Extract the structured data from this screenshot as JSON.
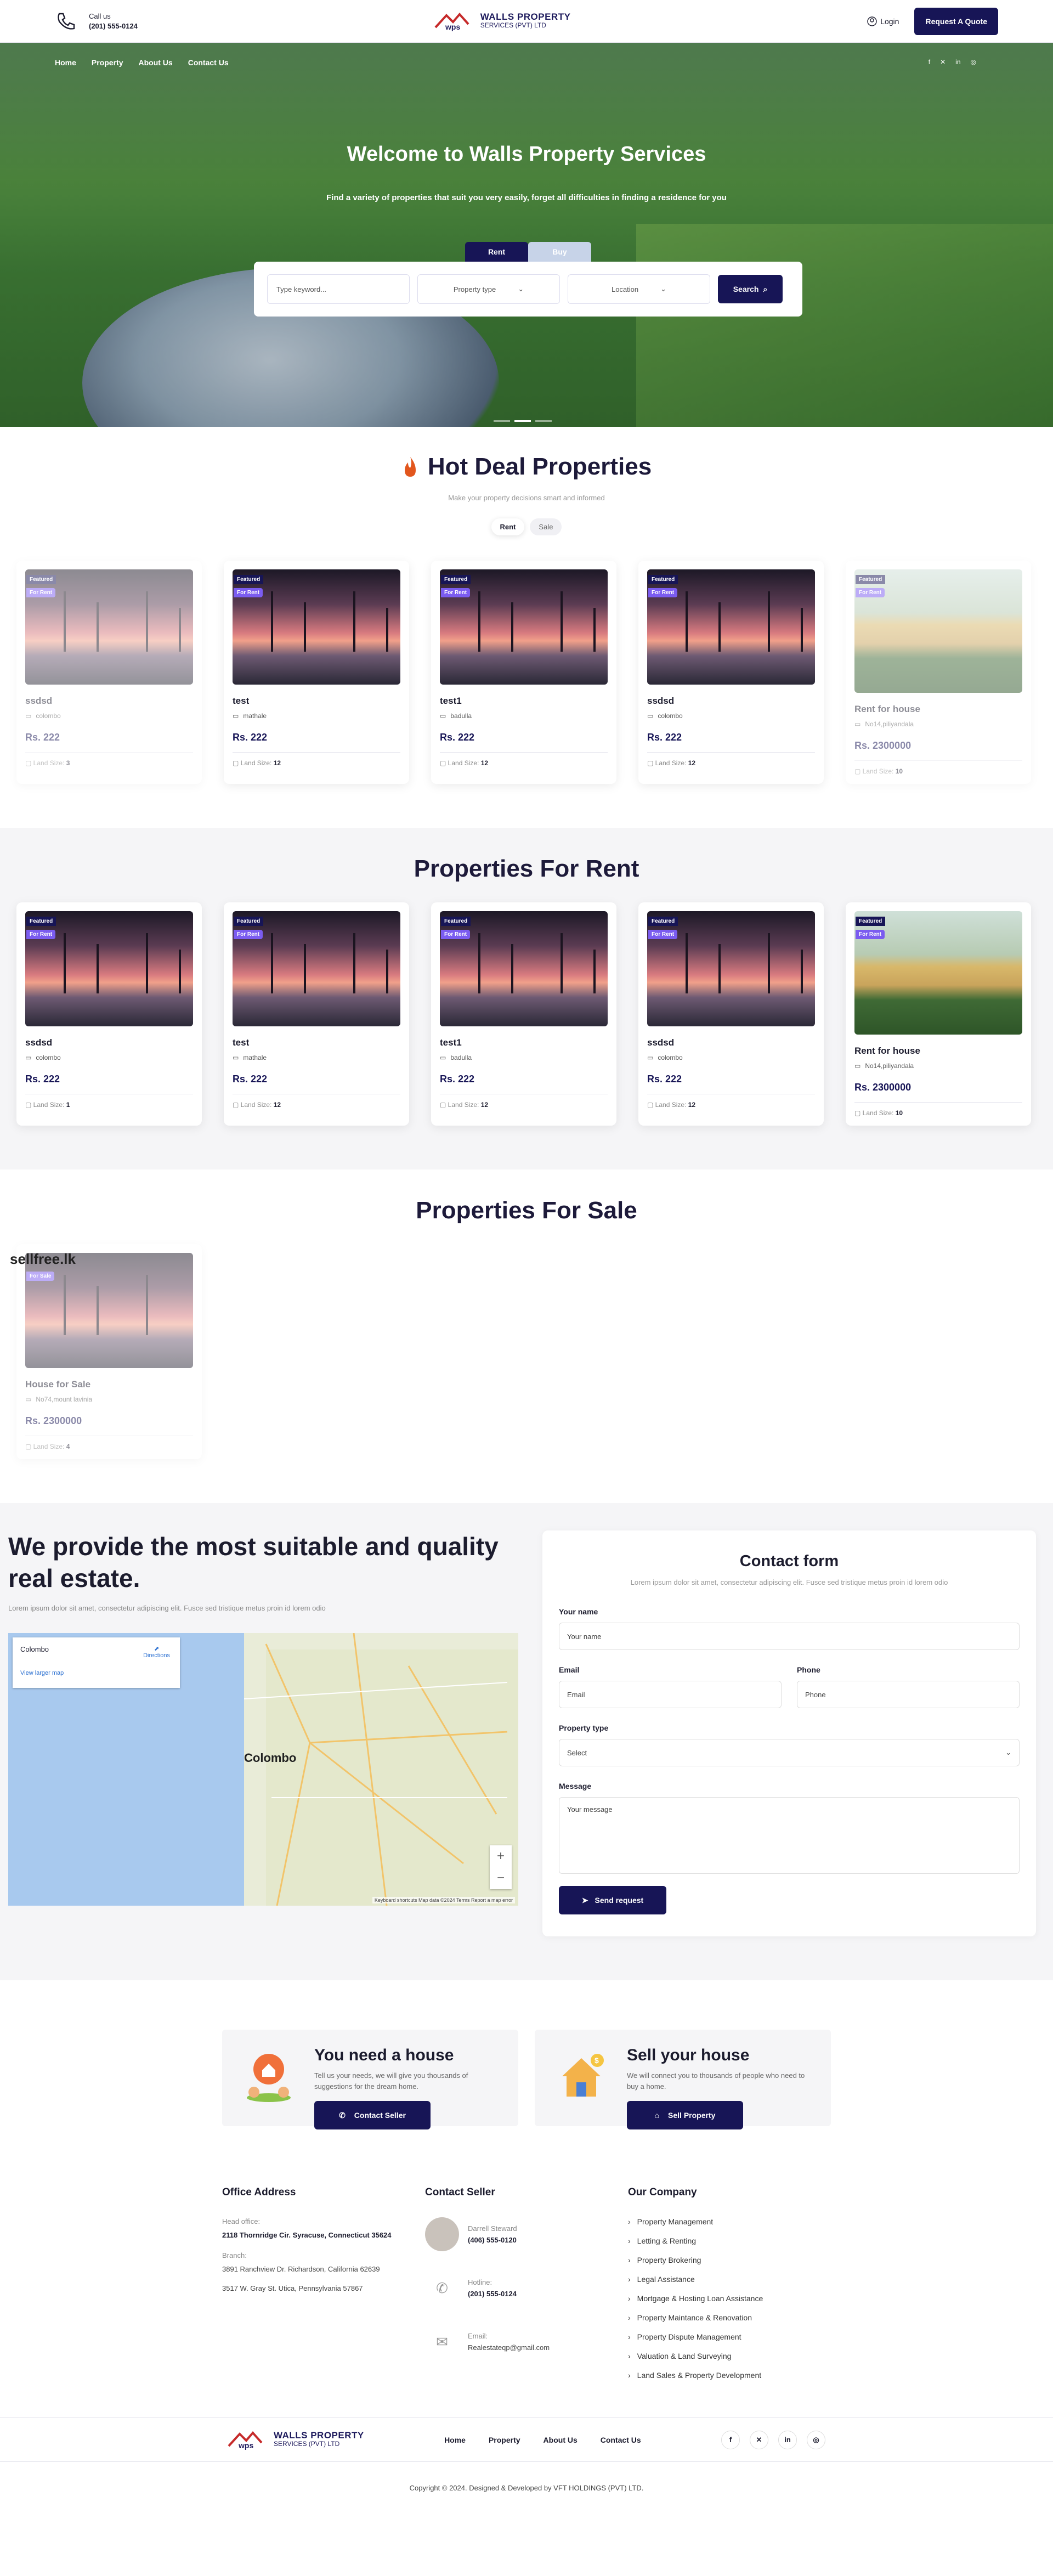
{
  "topbar": {
    "call_label": "Call us",
    "phone": "(201) 555-0124",
    "logo_line1": "WALLS PROPERTY",
    "logo_line2": "SERVICES (PVT) LTD",
    "login": "Login",
    "quote": "Request A Quote"
  },
  "nav": [
    "Home",
    "Property",
    "About Us",
    "Contact Us"
  ],
  "hero": {
    "title": "Welcome to Walls Property Services",
    "subtitle": "Find a variety of properties that suit you very easily, forget all difficulties in finding a residence for you",
    "tab_rent": "Rent",
    "tab_buy": "Buy",
    "keyword_placeholder": "Type keyword...",
    "property_type": "Property type",
    "location": "Location",
    "search": "Search"
  },
  "hot": {
    "title": "Hot Deal Properties",
    "subtitle": "Make your property decisions smart and informed",
    "pill_rent": "Rent",
    "pill_sale": "Sale",
    "cards": [
      {
        "b1": "Featured",
        "b2": "For Rent",
        "name": "ssdsd",
        "loc": "colombo",
        "price": "Rs. 222",
        "land": "Land Size:",
        "size": "3"
      },
      {
        "b1": "Featured",
        "b2": "For Rent",
        "name": "test",
        "loc": "mathale",
        "price": "Rs. 222",
        "land": "Land Size:",
        "size": "12"
      },
      {
        "b1": "Featured",
        "b2": "For Rent",
        "name": "test1",
        "loc": "badulla",
        "price": "Rs. 222",
        "land": "Land Size:",
        "size": "12"
      },
      {
        "b1": "Featured",
        "b2": "For Rent",
        "name": "ssdsd",
        "loc": "colombo",
        "price": "Rs. 222",
        "land": "Land Size:",
        "size": "12"
      },
      {
        "b1": "Featured",
        "b2": "For Rent",
        "name": "Rent for house",
        "loc": "No14,piliyandala",
        "price": "Rs. 2300000",
        "land": "Land Size:",
        "size": "10"
      }
    ]
  },
  "rent": {
    "title": "Properties For Rent",
    "cards": [
      {
        "b1": "Featured",
        "b2": "For Rent",
        "name": "ssdsd",
        "loc": "colombo",
        "price": "Rs. 222",
        "land": "Land Size:",
        "size": "1"
      },
      {
        "b1": "Featured",
        "b2": "For Rent",
        "name": "test",
        "loc": "mathale",
        "price": "Rs. 222",
        "land": "Land Size:",
        "size": "12"
      },
      {
        "b1": "Featured",
        "b2": "For Rent",
        "name": "test1",
        "loc": "badulla",
        "price": "Rs. 222",
        "land": "Land Size:",
        "size": "12"
      },
      {
        "b1": "Featured",
        "b2": "For Rent",
        "name": "ssdsd",
        "loc": "colombo",
        "price": "Rs. 222",
        "land": "Land Size:",
        "size": "12"
      },
      {
        "b1": "Featured",
        "b2": "For Rent",
        "name": "Rent for house",
        "loc": "No14,piliyandala",
        "price": "Rs. 2300000",
        "land": "Land Size:",
        "size": "10"
      }
    ]
  },
  "sale": {
    "title": "Properties For Sale",
    "watermark": "sellfree.lk",
    "card": {
      "b2": "For Sale",
      "name": "House for Sale",
      "loc": "No74,mount lavinia",
      "price": "Rs. 2300000",
      "land": "Land Size:",
      "size": "4"
    }
  },
  "provide": {
    "title": "We provide the most suitable and quality real estate.",
    "text": "Lorem ipsum dolor sit amet, consectetur adipiscing elit. Fusce sed tristique metus proin id lorem odio"
  },
  "map": {
    "place": "Colombo",
    "directions": "Directions",
    "larger": "View larger map",
    "city": "Colombo",
    "footer": "Keyboard shortcuts   Map data ©2024   Terms   Report a map error"
  },
  "form": {
    "title": "Contact form",
    "subtitle": "Lorem ipsum dolor sit amet, consectetur adipiscing elit. Fusce sed tristique metus proin id lorem odio",
    "name_label": "Your name",
    "name_ph": "Your name",
    "email_label": "Email",
    "email_ph": "Email",
    "phone_label": "Phone",
    "phone_ph": "Phone",
    "type_label": "Property type",
    "type_value": "Select",
    "msg_label": "Message",
    "msg_ph": "Your message",
    "send": "Send request"
  },
  "promo": [
    {
      "title": "You need a house",
      "text": "Tell us your needs, we will give you thousands of suggestions for the dream home.",
      "btn": "Contact Seller"
    },
    {
      "title": "Sell your house",
      "text": "We will connect you to thousands of people who need to buy a home.",
      "btn": "Sell Property"
    }
  ],
  "footer": {
    "office_title": "Office Address",
    "head_label": "Head office:",
    "head": "2118 Thornridge Cir. Syracuse, Connecticut 35624",
    "branch_label": "Branch:",
    "branch1": "3891 Ranchview Dr. Richardson, California 62639",
    "branch2": "3517 W. Gray St. Utica, Pennsylvania 57867",
    "seller_title": "Contact Seller",
    "seller_name": "Darrell Steward",
    "seller_phone": "(406) 555-0120",
    "hotline_label": "Hotline:",
    "hotline": "(201) 555-0124",
    "email_label": "Email:",
    "email": "Realestateqp@gmail.com",
    "company_title": "Our Company",
    "links": [
      "Property Management",
      "Letting & Renting",
      "Property Brokering",
      "Legal Assistance",
      "Mortgage & Hosting Loan Assistance",
      "Property Maintance & Renovation",
      "Property Dispute Management",
      "Valuation & Land Surveying",
      "Land Sales & Property Development"
    ],
    "nav": [
      "Home",
      "Property",
      "About Us",
      "Contact Us"
    ],
    "copyright": "Copyright © 2024. Designed & Developed by VFT HOLDINGS (PVT) LTD."
  }
}
